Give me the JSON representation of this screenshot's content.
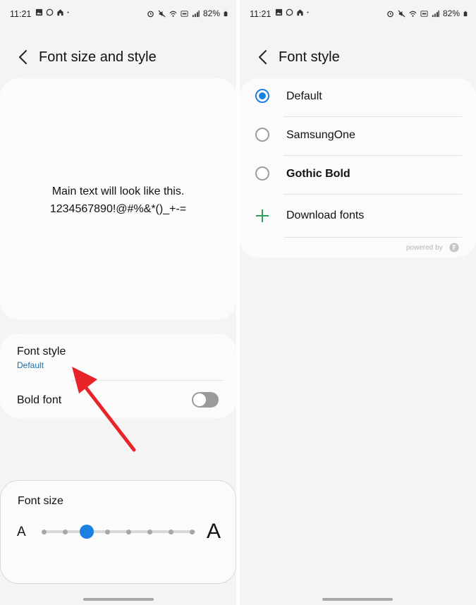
{
  "left_screen": {
    "status_bar": {
      "time": "11:21",
      "battery": "82%"
    },
    "header": {
      "title": "Font size and style"
    },
    "preview": {
      "line1": "Main text will look like this.",
      "line2": "1234567890!@#%&*()_+-="
    },
    "font_style_row": {
      "title": "Font style",
      "value": "Default"
    },
    "bold_font_row": {
      "title": "Bold font",
      "enabled": false
    },
    "font_size": {
      "title": "Font size",
      "small_label": "A",
      "large_label": "A",
      "steps": 8,
      "selected_step": 3
    }
  },
  "right_screen": {
    "status_bar": {
      "time": "11:21",
      "battery": "82%"
    },
    "header": {
      "title": "Font style"
    },
    "options": [
      {
        "label": "Default",
        "selected": true
      },
      {
        "label": "SamsungOne",
        "selected": false
      },
      {
        "label": "Gothic Bold",
        "selected": false
      }
    ],
    "download": {
      "label": "Download fonts"
    },
    "powered_by": "powered by"
  },
  "colors": {
    "accent": "#1c7fe3",
    "link": "#1b6ea8",
    "arrow": "#e8232a",
    "plus": "#2e9e5a"
  },
  "icons": [
    "back-arrow-icon",
    "gallery-icon",
    "whatsapp-icon",
    "home-icon",
    "alarm-icon",
    "mute-icon",
    "wifi-icon",
    "volte-icon",
    "signal-icon",
    "battery-icon",
    "plus-icon",
    "provider-logo-icon"
  ]
}
